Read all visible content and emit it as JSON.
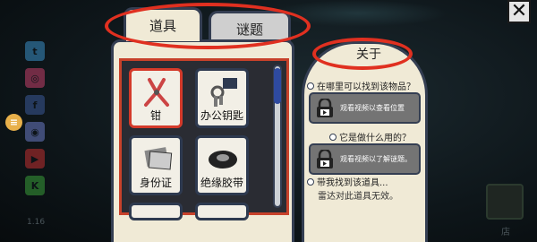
{
  "tabs": [
    {
      "label": "道具",
      "active": true
    },
    {
      "label": "谜题",
      "active": false
    }
  ],
  "items": [
    {
      "label": "钳",
      "icon": "pliers-icon",
      "selected": true
    },
    {
      "label": "办公钥匙",
      "icon": "keys-icon",
      "selected": false
    },
    {
      "label": "身份证",
      "icon": "id-card-icon",
      "selected": false
    },
    {
      "label": "绝缘胶带",
      "icon": "tape-icon",
      "selected": false
    }
  ],
  "about": {
    "title": "关于",
    "q1": "在哪里可以找到该物品？",
    "video1": "观看视频以查看位置",
    "q2": "它是做什么用的？",
    "video2": "观看视频以了解谜题。",
    "q3": "带我找到该道具...",
    "note": "雷达对此道具无效。"
  },
  "ui": {
    "close": "✕",
    "menu": "≡",
    "version": "1.16",
    "shop": "店"
  },
  "colors": {
    "panel": "#f0ead6",
    "border": "#343e52",
    "highlight": "#e03020",
    "selected": "#d43a2a"
  }
}
